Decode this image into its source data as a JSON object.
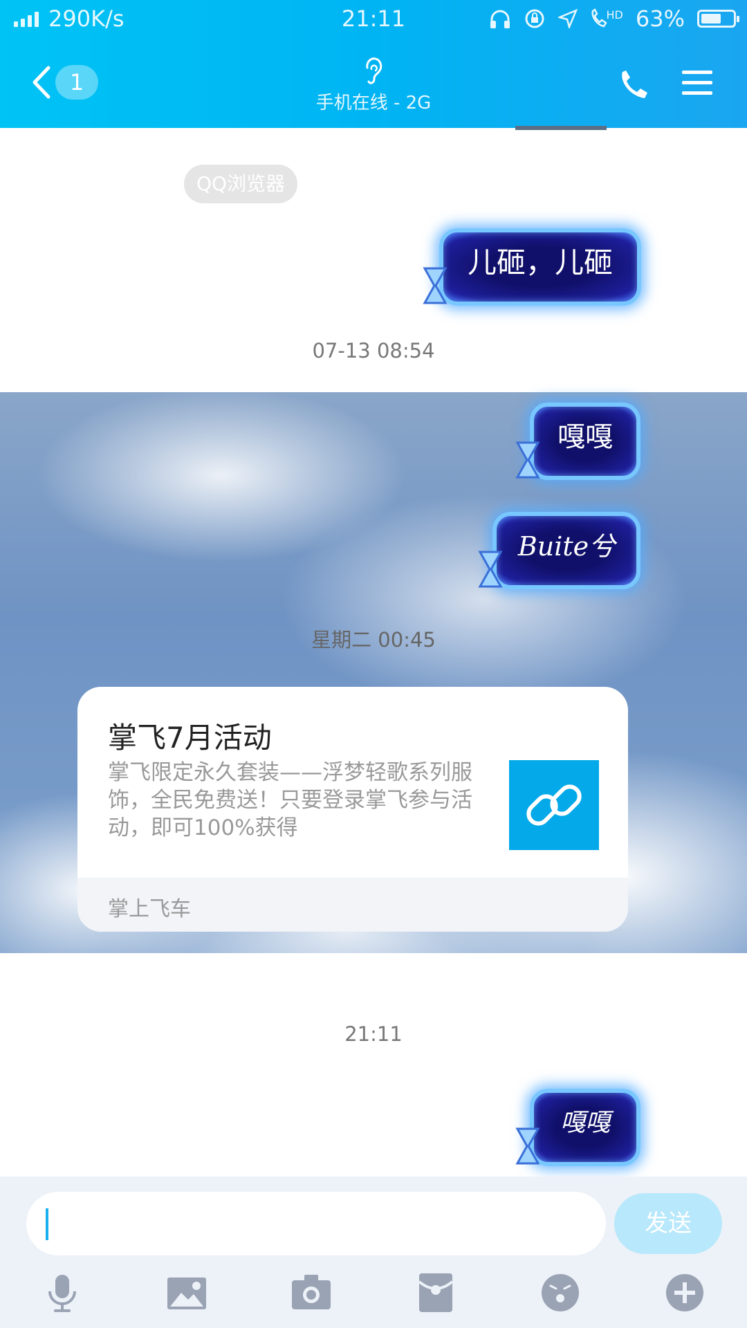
{
  "status_bar": {
    "net_speed": "290K/s",
    "time": "21:11",
    "hd_label": "HD",
    "battery": "63%",
    "battery_level": 0.63
  },
  "nav": {
    "unread_count": "1",
    "subtitle": "手机在线 - 2G"
  },
  "chat": {
    "system_chip": "QQ浏览器",
    "messages": [
      {
        "text": "儿砸，儿砸"
      },
      {
        "text": "嘎嘎"
      },
      {
        "text": "Buite兮"
      },
      {
        "text": "嘎嘎"
      }
    ],
    "timestamps": [
      "07-13 08:54",
      "星期二 00:45",
      "21:11"
    ],
    "share_card": {
      "title": "掌飞7月活动",
      "description": "掌飞限定永久套装——浮梦轻歌系列服饰，全民免费送！只要登录掌飞参与活动，即可100%获得",
      "source": "掌上飞车"
    }
  },
  "input": {
    "send_label": "发送",
    "value": ""
  },
  "colors": {
    "header_start": "#00c3f5",
    "header_end": "#1aa6f0",
    "bubble_fill": "#10106a",
    "bubble_glow": "#79c7ff",
    "link_thumb": "#03a9e8",
    "send_disabled": "#b8e8fb"
  },
  "toolbar_icons": [
    "microphone-icon",
    "image-icon",
    "camera-icon",
    "red-packet-icon",
    "emoji-icon",
    "plus-icon"
  ]
}
